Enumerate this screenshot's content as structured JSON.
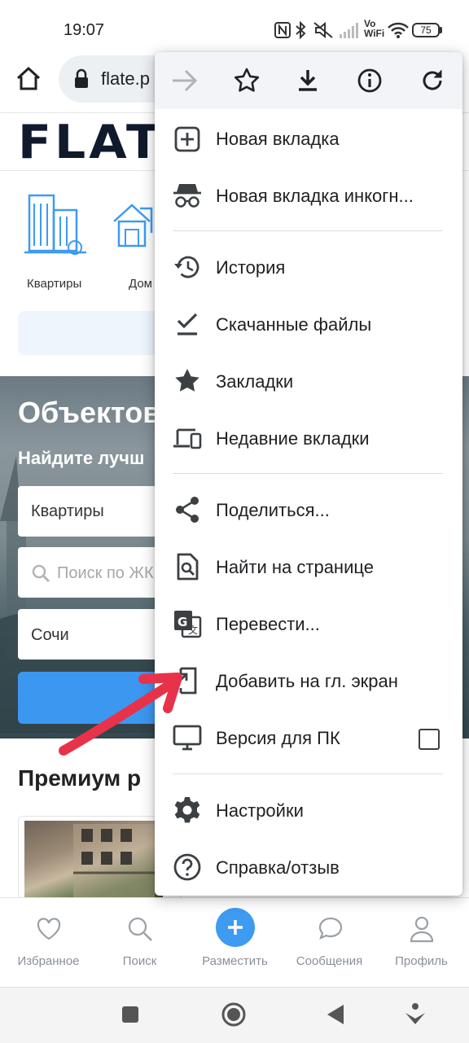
{
  "status_bar": {
    "time": "19:07",
    "battery": "75",
    "network_label_top": "Vo",
    "network_label_bottom": "WiFi"
  },
  "browser": {
    "url": "flate.p",
    "toolbar_icons": [
      "home-icon",
      "lock-icon",
      "forward-icon",
      "star-icon",
      "download-icon",
      "info-icon",
      "refresh-icon"
    ]
  },
  "page": {
    "logo": "FLATE",
    "categories": [
      "Квартиры",
      "Дом"
    ],
    "hero_title": "Объектов",
    "hero_subtitle": "Найдите лучш",
    "fields": {
      "type_value": "Квартиры",
      "search_placeholder": "Поиск по ЖК",
      "city_value": "Сочи"
    },
    "premium_title": "Премиум р"
  },
  "menu": {
    "items": [
      {
        "label": "Новая вкладка",
        "icon": "add-tab-icon"
      },
      {
        "label": "Новая вкладка инкогн...",
        "icon": "incognito-icon"
      },
      {
        "label": "История",
        "icon": "history-icon"
      },
      {
        "label": "Скачанные файлы",
        "icon": "downloads-check-icon"
      },
      {
        "label": "Закладки",
        "icon": "bookmarks-star-icon"
      },
      {
        "label": "Недавние вкладки",
        "icon": "devices-icon"
      },
      {
        "label": "Поделиться...",
        "icon": "share-icon"
      },
      {
        "label": "Найти на странице",
        "icon": "find-in-page-icon"
      },
      {
        "label": "Перевести...",
        "icon": "translate-icon"
      },
      {
        "label": "Добавить на гл. экран",
        "icon": "add-to-home-icon"
      },
      {
        "label": "Версия для ПК",
        "icon": "desktop-icon",
        "checked": false
      },
      {
        "label": "Настройки",
        "icon": "settings-gear-icon"
      },
      {
        "label": "Справка/отзыв",
        "icon": "help-icon"
      }
    ]
  },
  "bottom_nav": {
    "items": [
      {
        "label": "Избранное",
        "icon": "heart-icon"
      },
      {
        "label": "Поиск",
        "icon": "search-icon"
      },
      {
        "label": "Разместить",
        "icon": "plus-icon"
      },
      {
        "label": "Сообщения",
        "icon": "chat-icon"
      },
      {
        "label": "Профиль",
        "icon": "profile-icon"
      }
    ]
  },
  "colors": {
    "accent": "#3d9bf2",
    "annotation_arrow": "#e8324a",
    "menu_text": "#202124",
    "nav_text": "#8a8f99"
  }
}
